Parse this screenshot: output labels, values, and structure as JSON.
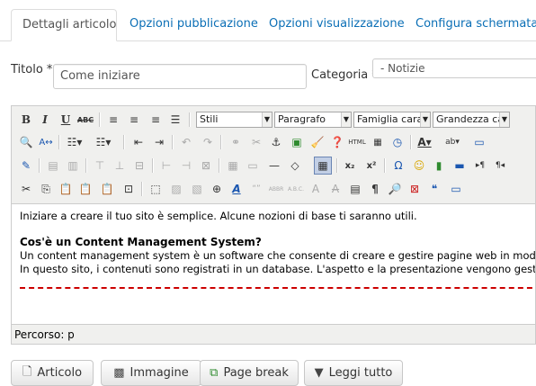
{
  "tabs": [
    {
      "label": "Dettagli articolo",
      "active": true
    },
    {
      "label": "Opzioni pubblicazione"
    },
    {
      "label": "Opzioni visualizzazione"
    },
    {
      "label": "Configura schermata di"
    }
  ],
  "form": {
    "title_label": "Titolo *",
    "title_value": "Come iniziare",
    "category_label": "Categoria *",
    "category_value": "- Notizie"
  },
  "toolbar": {
    "styles": "Stili",
    "format": "Paragrafo",
    "font_family": "Famiglia caratt",
    "font_size": "Grandezza cara"
  },
  "content": {
    "intro": "Iniziare a creare il tuo sito è semplice. Alcune nozioni di base ti saranno utili.",
    "heading": "Cos'è un Content Management System?",
    "line1": "Un content management system è un software che consente di creare e gestire pagine web in modo sempl",
    "line2": "In questo sito, i contenuti sono registrati in un database. L'aspetto e la presentazione vengono gestiti dal t"
  },
  "status": {
    "path": "Percorso: p"
  },
  "buttons": {
    "article": "Articolo",
    "image": "Immagine",
    "pagebreak": "Page break",
    "readmore": "Leggi tutto"
  }
}
